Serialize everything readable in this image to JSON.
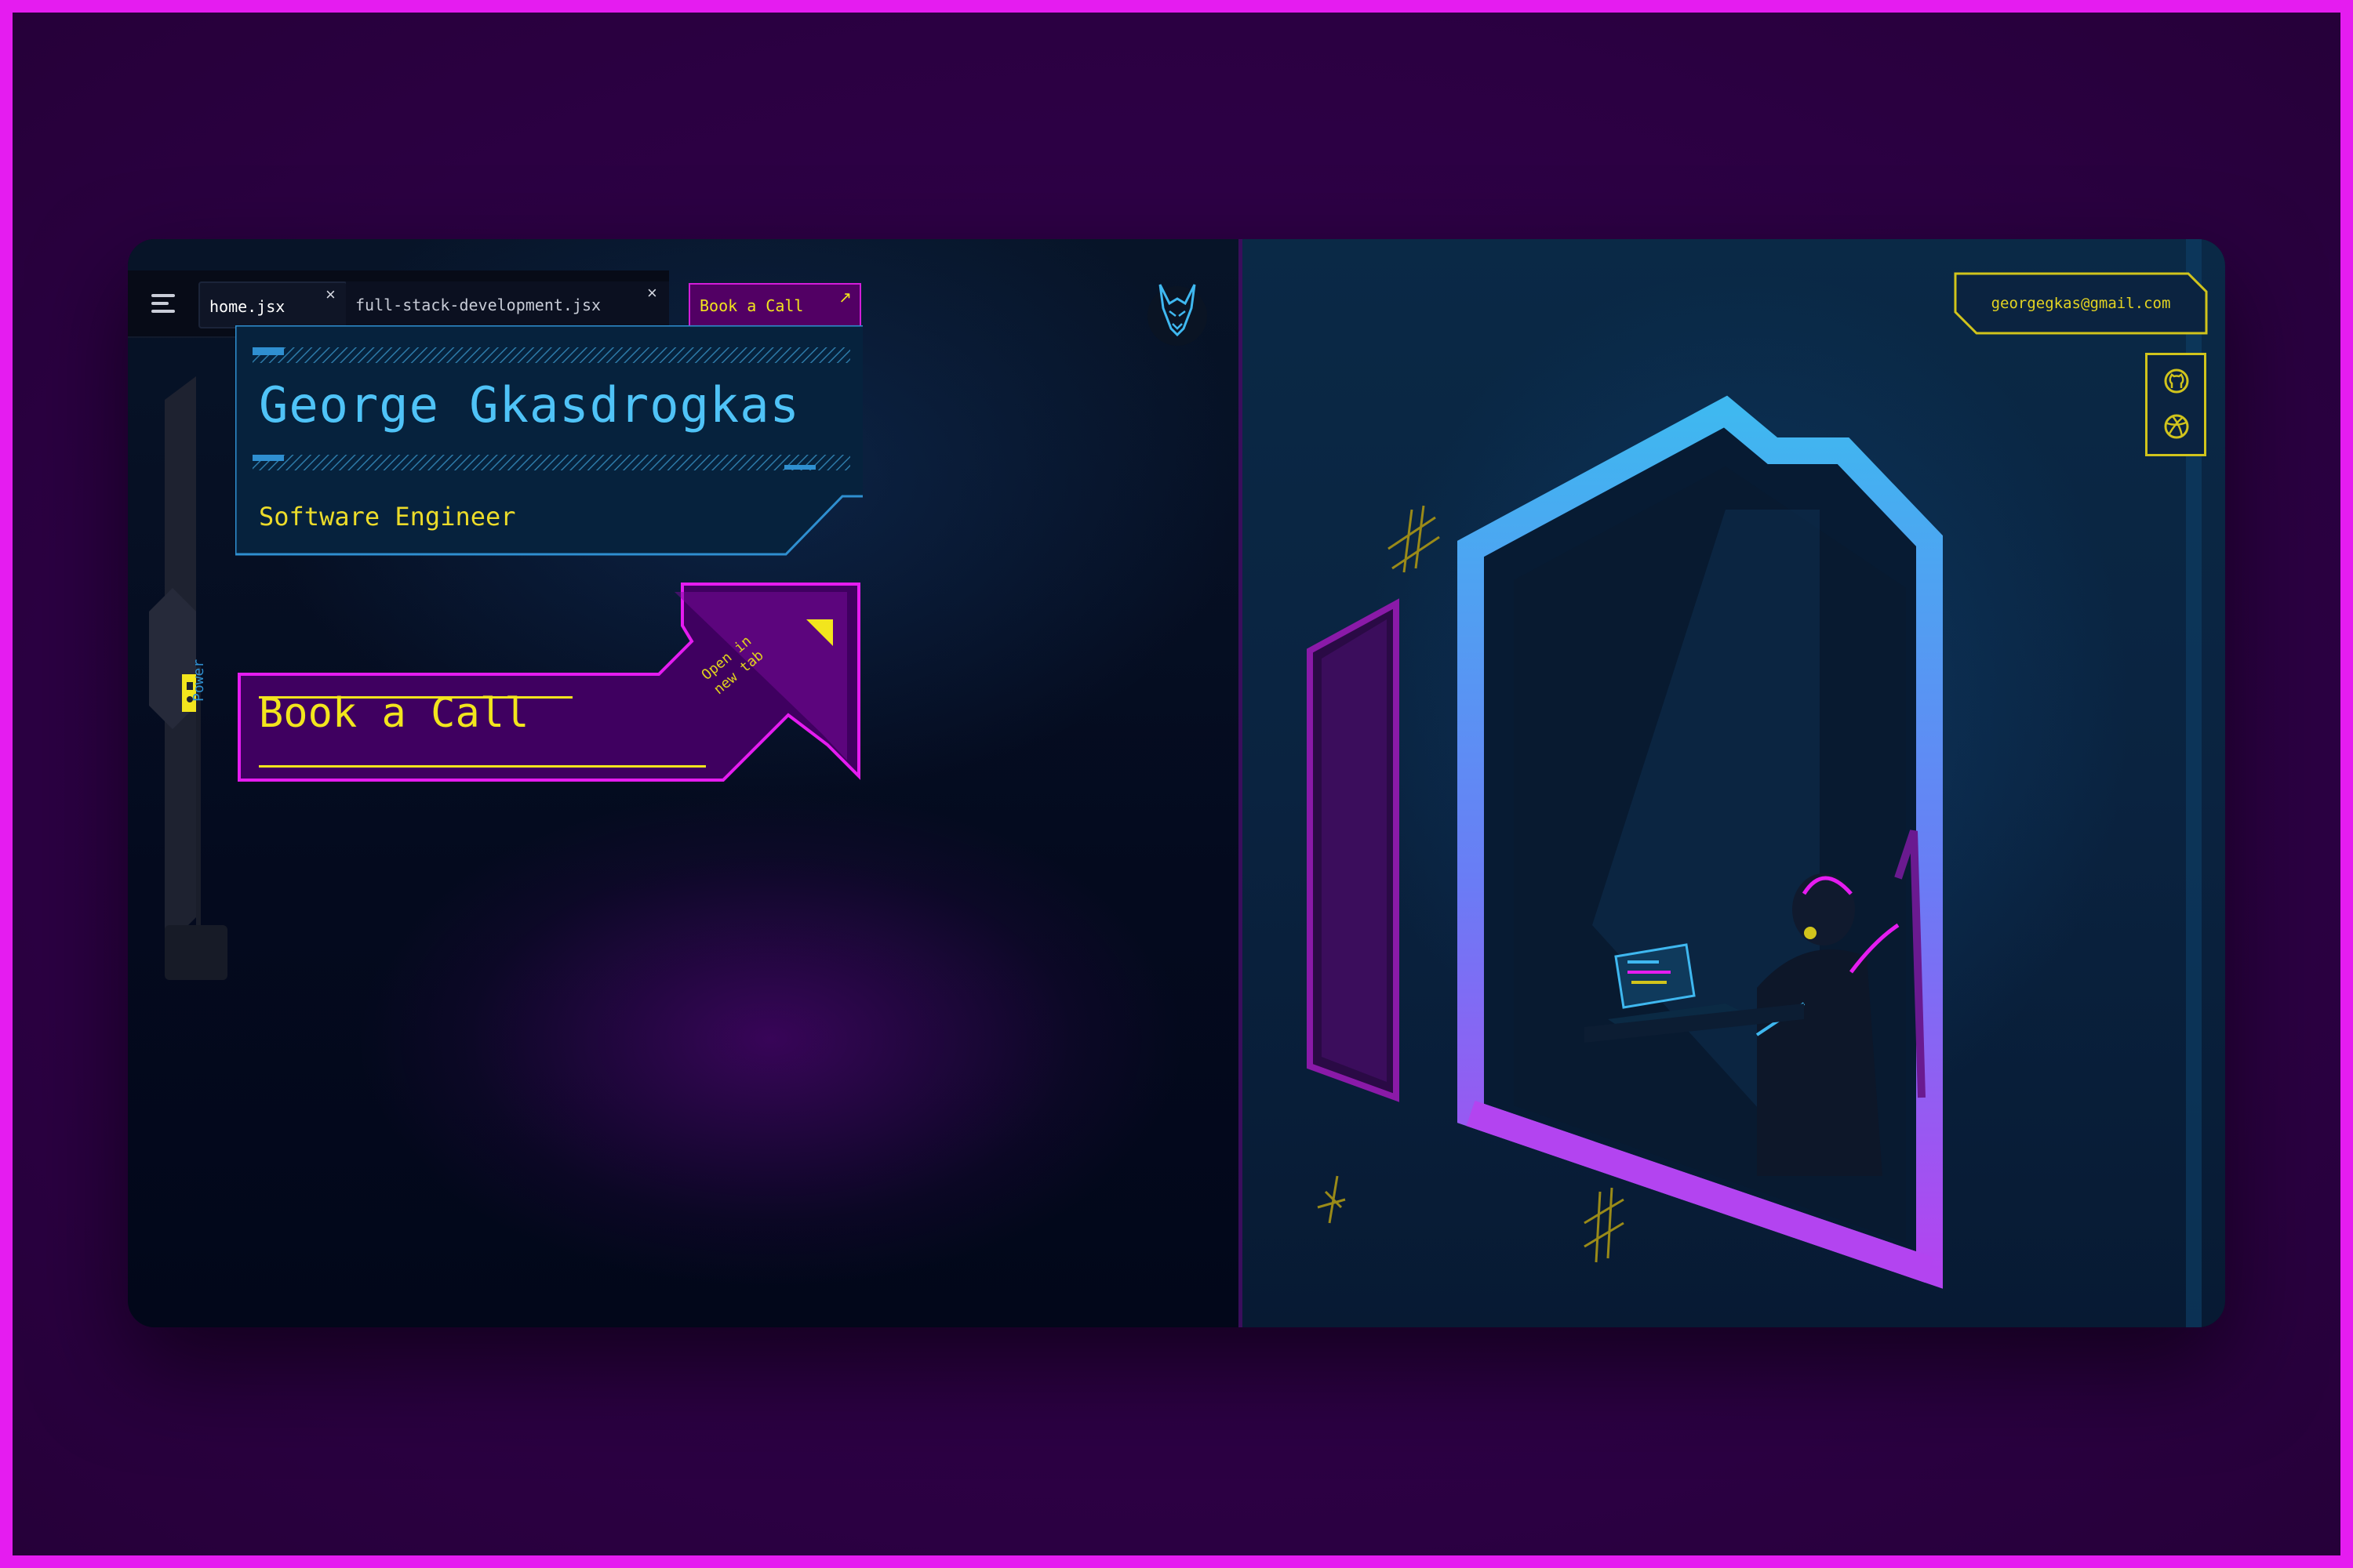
{
  "tabs": [
    {
      "label": "home.jsx",
      "close": "×"
    },
    {
      "label": "full-stack-development.jsx",
      "close": "×"
    }
  ],
  "book_tab": {
    "label": "Book a Call",
    "icon": "↗"
  },
  "hero": {
    "name": "George Gkasdrogkas",
    "role": "Software Engineer",
    "book_label": "Book a Call",
    "open_tab_line1": "Open in",
    "open_tab_line2": "new tab"
  },
  "power": {
    "label": "Power"
  },
  "contact": {
    "email": "georgegkas@gmail.com"
  },
  "social": [
    "github-icon",
    "dribbble-icon"
  ],
  "colors": {
    "accent_yellow": "#f2e51d",
    "accent_cyan": "#4fc3f7",
    "accent_magenta": "#e51cf0",
    "background": "#2e0049"
  }
}
